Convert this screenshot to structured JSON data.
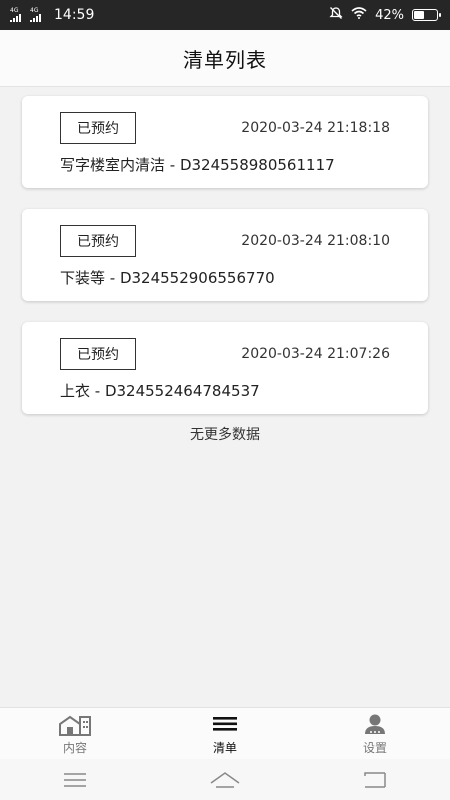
{
  "status_bar": {
    "network_1": "4G",
    "network_2": "4G",
    "time": "14:59",
    "battery_percent": "42%",
    "battery_level": 0.42,
    "icons": [
      "signal-icon",
      "signal-icon",
      "mute-icon",
      "wifi-icon",
      "battery-icon"
    ]
  },
  "header": {
    "title": "清单列表"
  },
  "orders": [
    {
      "status": "已预约",
      "time": "2020-03-24 21:18:18",
      "desc": "写字楼室内清洁 - D324558980561117"
    },
    {
      "status": "已预约",
      "time": "2020-03-24 21:08:10",
      "desc": "下装等 - D324552906556770"
    },
    {
      "status": "已预约",
      "time": "2020-03-24 21:07:26",
      "desc": "上衣 - D324552464784537"
    }
  ],
  "footer_text": "无更多数据",
  "nav": {
    "items": [
      {
        "label": "内容",
        "icon": "building-icon",
        "active": false
      },
      {
        "label": "清单",
        "icon": "list-icon",
        "active": true
      },
      {
        "label": "设置",
        "icon": "person-icon",
        "active": false
      }
    ]
  },
  "system_nav": {
    "icons": [
      "menu-icon",
      "home-icon",
      "back-icon"
    ]
  },
  "colors": {
    "status_bar_bg": "#262626",
    "page_bg": "#f2f2f2",
    "card_bg": "#ffffff",
    "active": "#111111",
    "inactive": "#777777"
  }
}
